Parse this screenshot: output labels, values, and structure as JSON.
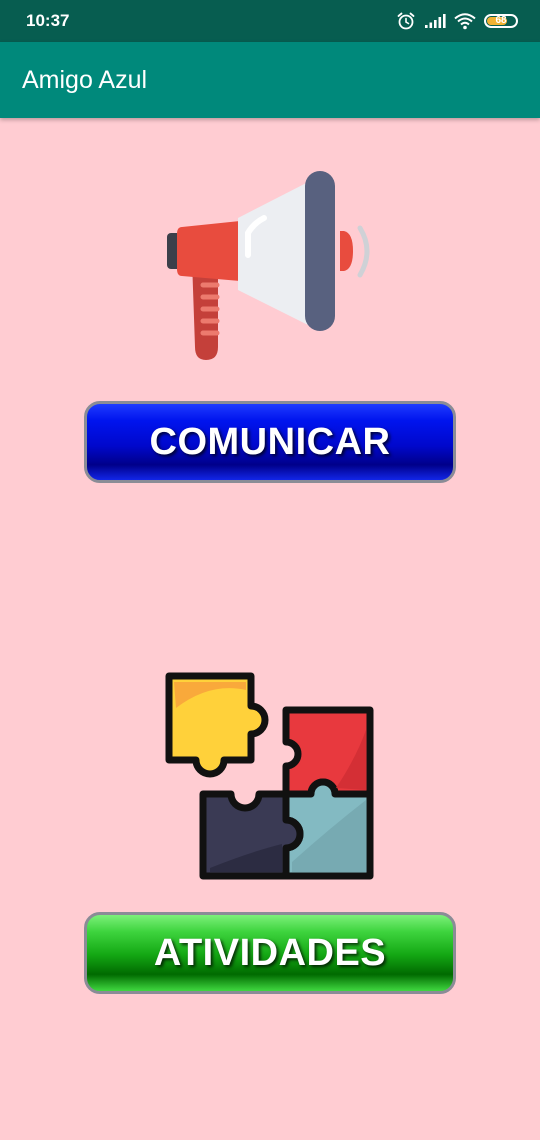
{
  "status_bar": {
    "time": "10:37",
    "battery_level": "68",
    "icons": [
      "alarm-icon",
      "signal-icon",
      "wifi-icon",
      "battery-icon"
    ]
  },
  "app_bar": {
    "title": "Amigo Azul",
    "color": "#00897b"
  },
  "main": {
    "background_color": "#ffccd2",
    "comunicar": {
      "icon": "megaphone-icon",
      "label": "COMUNICAR",
      "color": "#0008cc"
    },
    "atividades": {
      "icon": "puzzle-icon",
      "label": "ATIVIDADES",
      "color": "#14a814"
    }
  }
}
